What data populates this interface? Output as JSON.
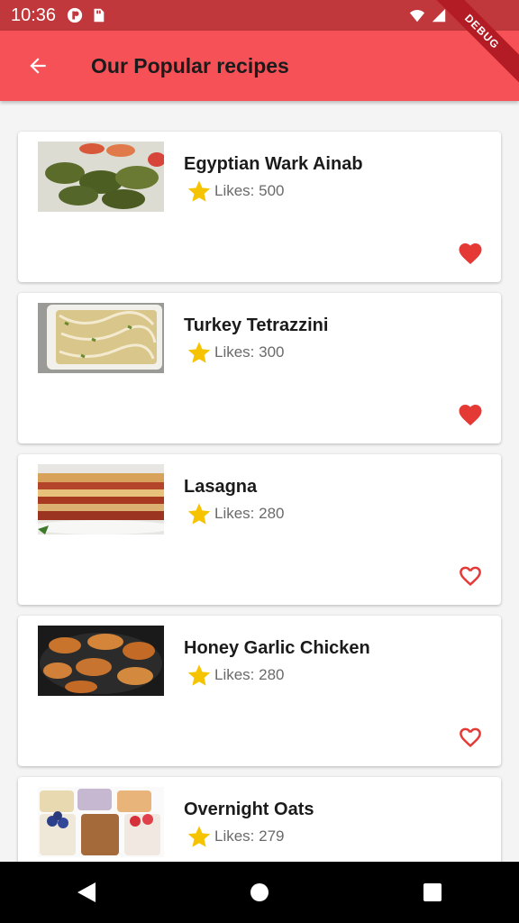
{
  "status_bar": {
    "time": "10:36"
  },
  "app_bar": {
    "title": "Our Popular recipes"
  },
  "debug_banner": {
    "label": "DEBUG"
  },
  "colors": {
    "app_bar": "#f65157",
    "status_bar": "#c0383b",
    "star": "#f6c300",
    "heart": "#e53935"
  },
  "recipes": [
    {
      "name": "Egyptian Wark Ainab",
      "likes": "Likes: 500",
      "favorite": true,
      "image": "stuffed-grape-leaves-photo"
    },
    {
      "name": "Turkey Tetrazzini",
      "likes": "Likes: 300",
      "favorite": true,
      "image": "pasta-bake-photo"
    },
    {
      "name": "Lasagna",
      "likes": "Likes: 280",
      "favorite": false,
      "image": "lasagna-photo"
    },
    {
      "name": "Honey Garlic Chicken",
      "likes": "Likes: 280",
      "favorite": false,
      "image": "grilled-chicken-photo"
    },
    {
      "name": "Overnight Oats",
      "likes": "Likes: 279",
      "favorite": false,
      "image": "oats-jars-photo"
    }
  ]
}
